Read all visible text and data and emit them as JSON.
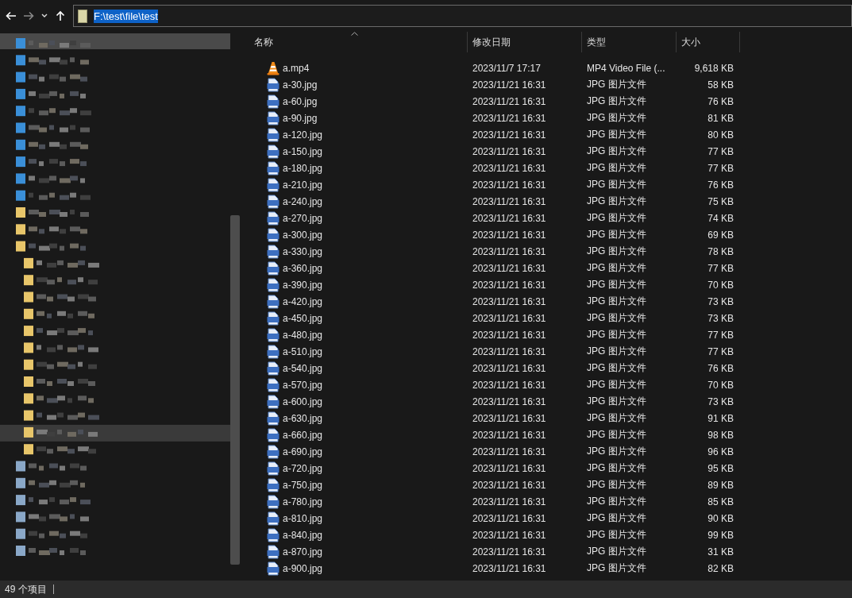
{
  "address_bar": {
    "path": "F:\\test\\file\\test",
    "text_selected": true
  },
  "columns": [
    {
      "label": "名称",
      "sorted": true
    },
    {
      "label": "修改日期",
      "sorted": false
    },
    {
      "label": "类型",
      "sorted": false
    },
    {
      "label": "大小",
      "sorted": false
    }
  ],
  "files": [
    {
      "kind": "video",
      "name": "a.mp4",
      "modified": "2023/11/7 17:17",
      "type": "MP4 Video File (...",
      "size": "9,618 KB"
    },
    {
      "kind": "image",
      "name": "a-30.jpg",
      "modified": "2023/11/21 16:31",
      "type": "JPG 图片文件",
      "size": "58 KB"
    },
    {
      "kind": "image",
      "name": "a-60.jpg",
      "modified": "2023/11/21 16:31",
      "type": "JPG 图片文件",
      "size": "76 KB"
    },
    {
      "kind": "image",
      "name": "a-90.jpg",
      "modified": "2023/11/21 16:31",
      "type": "JPG 图片文件",
      "size": "81 KB"
    },
    {
      "kind": "image",
      "name": "a-120.jpg",
      "modified": "2023/11/21 16:31",
      "type": "JPG 图片文件",
      "size": "80 KB"
    },
    {
      "kind": "image",
      "name": "a-150.jpg",
      "modified": "2023/11/21 16:31",
      "type": "JPG 图片文件",
      "size": "77 KB"
    },
    {
      "kind": "image",
      "name": "a-180.jpg",
      "modified": "2023/11/21 16:31",
      "type": "JPG 图片文件",
      "size": "77 KB"
    },
    {
      "kind": "image",
      "name": "a-210.jpg",
      "modified": "2023/11/21 16:31",
      "type": "JPG 图片文件",
      "size": "76 KB"
    },
    {
      "kind": "image",
      "name": "a-240.jpg",
      "modified": "2023/11/21 16:31",
      "type": "JPG 图片文件",
      "size": "75 KB"
    },
    {
      "kind": "image",
      "name": "a-270.jpg",
      "modified": "2023/11/21 16:31",
      "type": "JPG 图片文件",
      "size": "74 KB"
    },
    {
      "kind": "image",
      "name": "a-300.jpg",
      "modified": "2023/11/21 16:31",
      "type": "JPG 图片文件",
      "size": "69 KB"
    },
    {
      "kind": "image",
      "name": "a-330.jpg",
      "modified": "2023/11/21 16:31",
      "type": "JPG 图片文件",
      "size": "78 KB"
    },
    {
      "kind": "image",
      "name": "a-360.jpg",
      "modified": "2023/11/21 16:31",
      "type": "JPG 图片文件",
      "size": "77 KB"
    },
    {
      "kind": "image",
      "name": "a-390.jpg",
      "modified": "2023/11/21 16:31",
      "type": "JPG 图片文件",
      "size": "70 KB"
    },
    {
      "kind": "image",
      "name": "a-420.jpg",
      "modified": "2023/11/21 16:31",
      "type": "JPG 图片文件",
      "size": "73 KB"
    },
    {
      "kind": "image",
      "name": "a-450.jpg",
      "modified": "2023/11/21 16:31",
      "type": "JPG 图片文件",
      "size": "73 KB"
    },
    {
      "kind": "image",
      "name": "a-480.jpg",
      "modified": "2023/11/21 16:31",
      "type": "JPG 图片文件",
      "size": "77 KB"
    },
    {
      "kind": "image",
      "name": "a-510.jpg",
      "modified": "2023/11/21 16:31",
      "type": "JPG 图片文件",
      "size": "77 KB"
    },
    {
      "kind": "image",
      "name": "a-540.jpg",
      "modified": "2023/11/21 16:31",
      "type": "JPG 图片文件",
      "size": "76 KB"
    },
    {
      "kind": "image",
      "name": "a-570.jpg",
      "modified": "2023/11/21 16:31",
      "type": "JPG 图片文件",
      "size": "70 KB"
    },
    {
      "kind": "image",
      "name": "a-600.jpg",
      "modified": "2023/11/21 16:31",
      "type": "JPG 图片文件",
      "size": "73 KB"
    },
    {
      "kind": "image",
      "name": "a-630.jpg",
      "modified": "2023/11/21 16:31",
      "type": "JPG 图片文件",
      "size": "91 KB"
    },
    {
      "kind": "image",
      "name": "a-660.jpg",
      "modified": "2023/11/21 16:31",
      "type": "JPG 图片文件",
      "size": "98 KB"
    },
    {
      "kind": "image",
      "name": "a-690.jpg",
      "modified": "2023/11/21 16:31",
      "type": "JPG 图片文件",
      "size": "96 KB"
    },
    {
      "kind": "image",
      "name": "a-720.jpg",
      "modified": "2023/11/21 16:31",
      "type": "JPG 图片文件",
      "size": "95 KB"
    },
    {
      "kind": "image",
      "name": "a-750.jpg",
      "modified": "2023/11/21 16:31",
      "type": "JPG 图片文件",
      "size": "89 KB"
    },
    {
      "kind": "image",
      "name": "a-780.jpg",
      "modified": "2023/11/21 16:31",
      "type": "JPG 图片文件",
      "size": "85 KB"
    },
    {
      "kind": "image",
      "name": "a-810.jpg",
      "modified": "2023/11/21 16:31",
      "type": "JPG 图片文件",
      "size": "90 KB"
    },
    {
      "kind": "image",
      "name": "a-840.jpg",
      "modified": "2023/11/21 16:31",
      "type": "JPG 图片文件",
      "size": "99 KB"
    },
    {
      "kind": "image",
      "name": "a-870.jpg",
      "modified": "2023/11/21 16:31",
      "type": "JPG 图片文件",
      "size": "31 KB"
    },
    {
      "kind": "image",
      "name": "a-900.jpg",
      "modified": "2023/11/21 16:31",
      "type": "JPG 图片文件",
      "size": "82 KB"
    }
  ],
  "status_bar": {
    "item_count": "49 个项目"
  }
}
